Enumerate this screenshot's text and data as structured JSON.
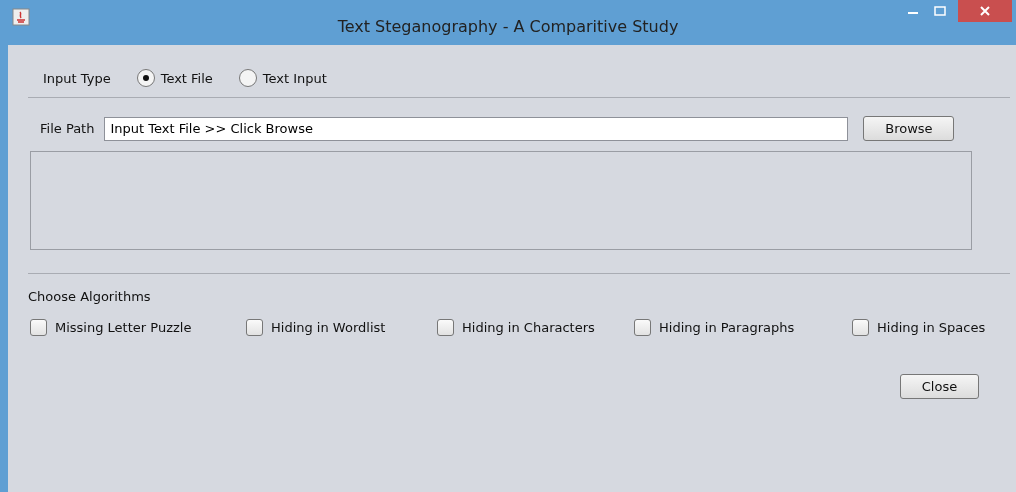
{
  "window": {
    "title": "Text Steganography - A Comparitive Study"
  },
  "input_type": {
    "label": "Input Type",
    "options": [
      {
        "label": "Text File",
        "selected": true
      },
      {
        "label": "Text Input",
        "selected": false
      }
    ]
  },
  "file_path": {
    "label": "File Path",
    "value": "Input Text File >> Click Browse",
    "button": "Browse"
  },
  "algorithms": {
    "label": "Choose Algorithms",
    "items": [
      {
        "label": "Missing Letter Puzzle",
        "checked": false
      },
      {
        "label": "Hiding in Wordlist",
        "checked": false
      },
      {
        "label": "Hiding in Characters",
        "checked": false
      },
      {
        "label": "Hiding in Paragraphs",
        "checked": false
      },
      {
        "label": "Hiding in Spaces",
        "checked": false
      }
    ]
  },
  "close_button": "Close"
}
